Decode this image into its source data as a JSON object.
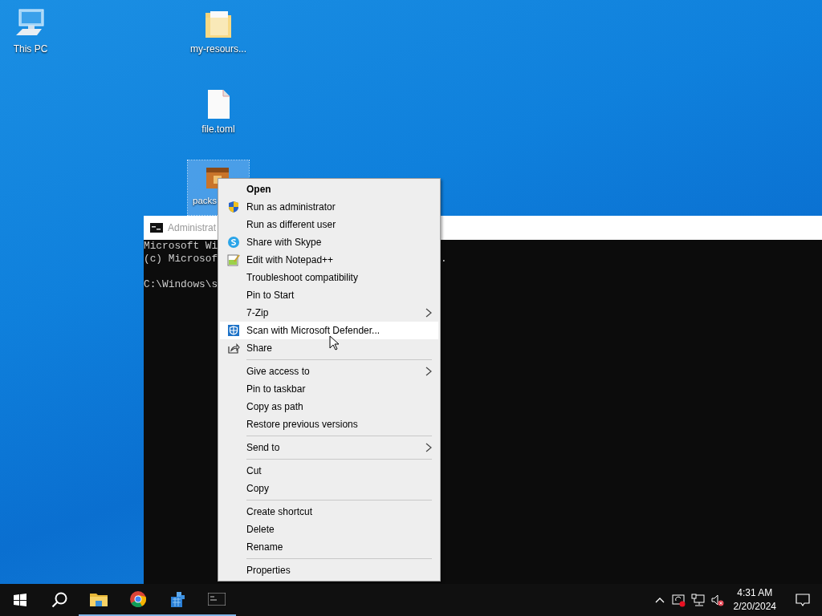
{
  "desktop_icons": [
    {
      "label": "This PC",
      "kind": "pc",
      "selected": false
    },
    {
      "label": "my-resours...",
      "kind": "folder",
      "selected": false
    },
    {
      "label": "file.toml",
      "kind": "file",
      "selected": false
    },
    {
      "label": "packs",
      "kind": "package",
      "selected": true
    }
  ],
  "console": {
    "title": "Administrat",
    "lines": [
      {
        "text": "Microsoft Wi"
      },
      {
        "text": "(c) Microsof",
        "tail": "."
      },
      {
        "text": "C:\\Windows\\s",
        "blank_line_before": true
      }
    ]
  },
  "context_menu": {
    "groups": [
      [
        {
          "label": "Open",
          "default": true,
          "selected": false
        },
        {
          "label": "Run as administrator",
          "kind": "shield",
          "selected": false
        },
        {
          "label": "Run as different user",
          "selected": false
        },
        {
          "label": "Share with Skype",
          "kind": "skype",
          "selected": false
        },
        {
          "label": "Edit with Notepad++",
          "kind": "notepad",
          "selected": false
        },
        {
          "label": "Troubleshoot compatibility",
          "selected": false
        },
        {
          "label": "Pin to Start",
          "selected": false
        },
        {
          "label": "7-Zip",
          "submenu": true,
          "selected": false
        },
        {
          "label": "Scan with Microsoft Defender...",
          "kind": "defender",
          "selected": true
        },
        {
          "label": "Share",
          "kind": "share",
          "selected": false
        }
      ],
      [
        {
          "label": "Give access to",
          "submenu": true,
          "selected": false
        },
        {
          "label": "Pin to taskbar",
          "selected": false
        },
        {
          "label": "Copy as path",
          "selected": false
        },
        {
          "label": "Restore previous versions",
          "selected": false
        }
      ],
      [
        {
          "label": "Send to",
          "submenu": true,
          "selected": false
        }
      ],
      [
        {
          "label": "Cut",
          "selected": false
        },
        {
          "label": "Copy",
          "selected": false
        }
      ],
      [
        {
          "label": "Create shortcut",
          "selected": false
        },
        {
          "label": "Delete",
          "selected": false
        },
        {
          "label": "Rename",
          "selected": false
        }
      ],
      [
        {
          "label": "Properties",
          "selected": false
        }
      ]
    ]
  },
  "taskbar": {
    "apps": [
      {
        "kind": "start",
        "running": false
      },
      {
        "kind": "search",
        "running": false
      },
      {
        "kind": "explorer",
        "running": true
      },
      {
        "kind": "chrome",
        "running": true
      },
      {
        "kind": "cube",
        "running": true
      },
      {
        "kind": "console",
        "running": true
      }
    ],
    "time": "4:31 AM",
    "date": "2/20/2024"
  }
}
